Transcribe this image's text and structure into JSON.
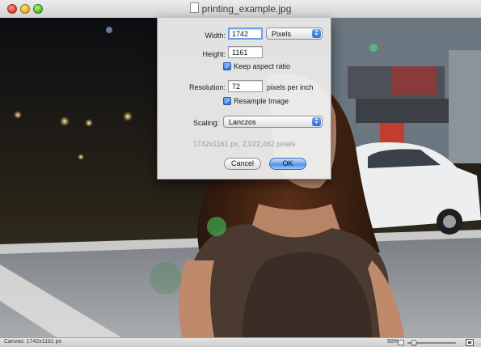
{
  "window": {
    "title": "printing_example.jpg"
  },
  "dialog": {
    "width_label": "Width:",
    "width_value": "1742",
    "unit_value": "Pixels",
    "height_label": "Height:",
    "height_value": "1161",
    "keep_aspect_label": "Keep aspect ratio",
    "keep_aspect_checked": true,
    "resolution_label": "Resolution:",
    "resolution_value": "72",
    "resolution_unit": "pixels per inch",
    "resample_label": "Resample Image",
    "resample_checked": true,
    "scaling_label": "Scaling:",
    "scaling_value": "Lanczos",
    "info_text": "1742x1161 px, 2,022,462 pixels",
    "cancel_label": "Cancel",
    "ok_label": "OK"
  },
  "status": {
    "canvas_text": "Canvas: 1742x1161 px",
    "zoom_text": "50%",
    "zoom_level": 0.5
  },
  "colors": {
    "accent": "#4d8be4",
    "window_bg": "#d2d2d2"
  }
}
